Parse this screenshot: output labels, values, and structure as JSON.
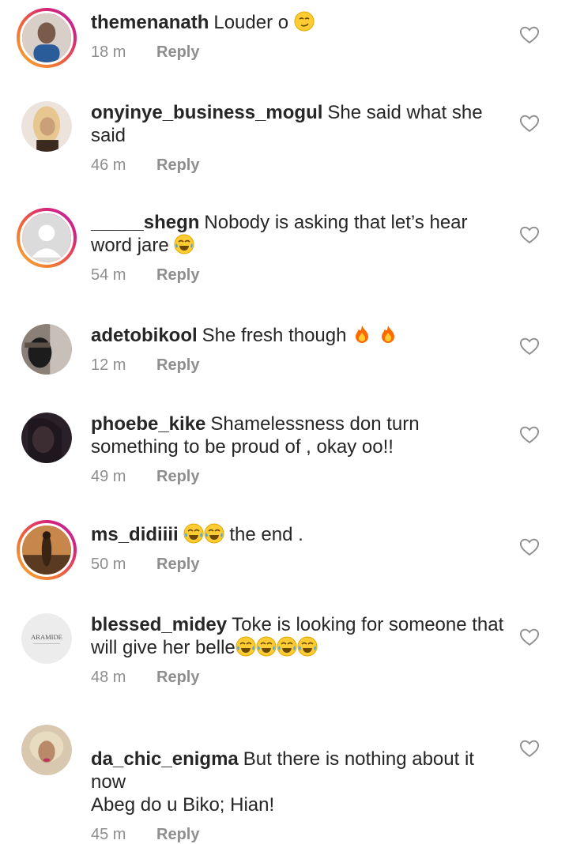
{
  "comments": [
    {
      "username": "themenanath",
      "text": "Louder o ",
      "emojis": [
        "smirking-face"
      ],
      "time": "18 m",
      "reply_label": "Reply",
      "has_story_ring": true,
      "avatar_colors": [
        "#7a5a4a",
        "#2b5c9a"
      ]
    },
    {
      "username": "onyinye_business_mogul",
      "text": "She said what she said",
      "emojis": [],
      "time": "46 m",
      "reply_label": "Reply",
      "has_story_ring": false,
      "avatar_colors": [
        "#e7c78f",
        "#3a2a20"
      ]
    },
    {
      "username": "_____shegn",
      "text": "Nobody is asking that let’s hear word jare ",
      "emojis": [
        "tears-of-joy"
      ],
      "time": "54 m",
      "reply_label": "Reply",
      "has_story_ring": true,
      "avatar_colors": [
        "#dbdbdb",
        "#ffffff"
      ]
    },
    {
      "username": "adetobikool",
      "text": "She fresh though ",
      "emojis": [
        "fire",
        "fire"
      ],
      "time": "12 m",
      "reply_label": "Reply",
      "has_story_ring": false,
      "avatar_colors": [
        "#5a5048",
        "#1c1c1c"
      ]
    },
    {
      "username": "phoebe_kike",
      "text": "Shamelessness don turn something to be proud of , okay oo!!",
      "emojis": [],
      "time": "49 m",
      "reply_label": "Reply",
      "has_story_ring": false,
      "avatar_colors": [
        "#2a2028",
        "#8a6a70"
      ]
    },
    {
      "username": "ms_didiiii",
      "text": " the end .",
      "emojis_before": [
        "tears-of-joy",
        "tears-of-joy"
      ],
      "emojis": [],
      "time": "50 m",
      "reply_label": "Reply",
      "has_story_ring": true,
      "avatar_colors": [
        "#c7864a",
        "#5a3a20"
      ]
    },
    {
      "username": "blessed_midey",
      "text": "Toke is looking for someone that will give her belle",
      "emojis": [
        "tears-of-joy",
        "tears-of-joy",
        "tears-of-joy",
        "tears-of-joy"
      ],
      "time": "48 m",
      "reply_label": "Reply",
      "has_story_ring": false,
      "avatar_logo": "ARAMIDE",
      "avatar_colors": [
        "#ececec",
        "#888888"
      ]
    },
    {
      "username": "da_chic_enigma",
      "text": "But there is nothing about it now\nAbeg do u Biko; Hian!",
      "emojis": [],
      "time": "45 m",
      "reply_label": "Reply",
      "has_story_ring": false,
      "avatar_colors": [
        "#d8c8b0",
        "#c03060"
      ]
    }
  ],
  "icons": {
    "like": "heart-outline-icon"
  },
  "colors": {
    "text": "#262626",
    "meta": "#8e8e8e",
    "ring": "#d6247c"
  }
}
